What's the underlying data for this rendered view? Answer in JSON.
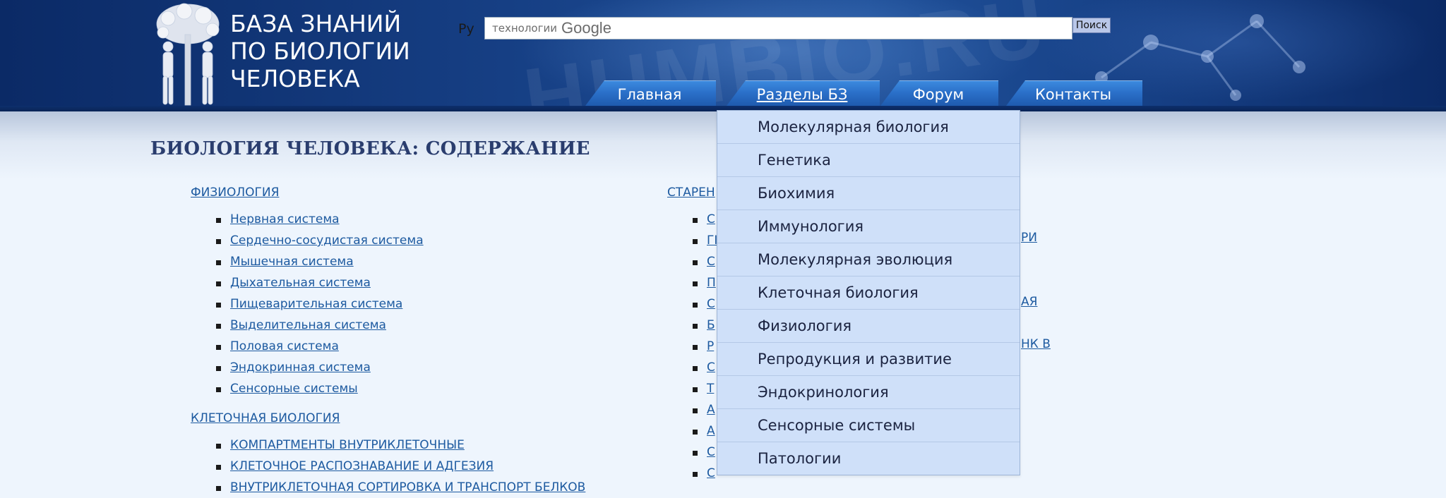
{
  "header": {
    "logo_lines": [
      "БАЗА ЗНАНИЙ",
      "ПО БИОЛОГИИ",
      "ЧЕЛОВЕКА"
    ],
    "lang": "Ру",
    "search": {
      "placeholder": "технологии",
      "brand": "Google",
      "button": "Поиск"
    },
    "watermark": "HUMBIO.RU",
    "nav": [
      {
        "label": "Главная"
      },
      {
        "label": "Разделы БЗ"
      },
      {
        "label": "Форум"
      },
      {
        "label": "Контакты"
      }
    ]
  },
  "main": {
    "title": "БИОЛОГИЯ ЧЕЛОВЕКА: СОДЕРЖАНИЕ",
    "left": {
      "sections": [
        {
          "title": "ФИЗИОЛОГИЯ",
          "items": [
            "Нервная система",
            "Сердечно-сосудистая система",
            "Мышечная система",
            "Дыхательная система",
            "Пищеварительная система",
            "Выделительная система",
            "Половая система",
            "Эндокринная система",
            "Сенсорные системы"
          ]
        },
        {
          "title": "КЛЕТОЧНАЯ БИОЛОГИЯ",
          "items": [
            "КОМПАРТМЕНТЫ ВНУТРИКЛЕТОЧНЫЕ",
            "КЛЕТОЧНОЕ РАСПОЗНАВАНИЕ И АДГЕЗИЯ",
            "ВНУТРИКЛЕТОЧНАЯ СОРТИРОВКА И ТРАНСПОРТ БЕЛКОВ"
          ]
        }
      ]
    },
    "right": {
      "section_title": "СТАРЕН",
      "fragments": [
        "С",
        "ГІ",
        "С",
        "П",
        "С",
        "Б",
        "Р",
        "С",
        "Т",
        "А",
        "А",
        "С",
        "С"
      ],
      "tails": [
        "РИ",
        "АЯ",
        "НК В"
      ]
    }
  },
  "dropdown": {
    "items": [
      "Молекулярная биология",
      "Генетика",
      "Биохимия",
      "Иммунология",
      "Молекулярная эволюция",
      "Клеточная биология",
      "Физиология",
      "Репродукция и развитие",
      "Эндокринология",
      "Сенсорные системы",
      "Патологии"
    ]
  }
}
